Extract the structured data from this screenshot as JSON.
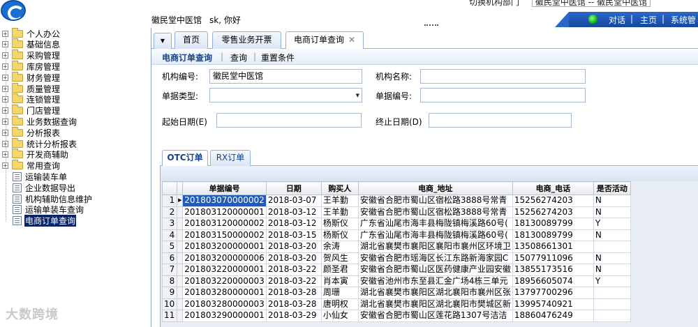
{
  "header": {
    "top_switch_label": "切换机构部门",
    "top_switch_value": "徽民堂中医馆 -- 徽民堂中医馆",
    "org_name": "徽民堂中医馆",
    "greeting": "sk, 你好",
    "nav": {
      "dialog": "对话",
      "home": "主页",
      "settings": "系统管"
    },
    "nav_sep": "|",
    "nav_color": "#1f56b3"
  },
  "tree": {
    "folders": [
      "个人办公",
      "基础信息",
      "采购管理",
      "库房管理",
      "财务管理",
      "质量管理",
      "连锁管理",
      "门店管理",
      "业务数据查询",
      "分析报表",
      "统计分析报表",
      "开发商辅助",
      "常用查询"
    ],
    "leaves": [
      "运输装车单",
      "企业数据导出",
      "机构辅助信息维护",
      "运输单装车查询",
      "电商订单查询"
    ],
    "selected": "电商订单查询",
    "expand_glyph": "+"
  },
  "watermark": "大数跨境",
  "tabs": {
    "menu_icon": "▼",
    "items": [
      "首页",
      "零售业务开票",
      "电商订单查询"
    ],
    "active": "电商订单查询",
    "close_glyph": "✕"
  },
  "toolbar": {
    "title": "电商订单查询",
    "query": "查询",
    "reset": "重置条件",
    "sep": "|"
  },
  "form": {
    "org_code_label": "机构编号:",
    "org_code_value": "徽民堂中医馆",
    "org_name_label": "机构名称:",
    "org_name_value": "",
    "doc_type_label": "单据类型:",
    "doc_type_value": "",
    "doc_no_label": "单据编号:",
    "doc_no_value": "",
    "start_label": "起始日期(E)",
    "start_value": "",
    "end_label": "终止日期(D)",
    "end_value": ""
  },
  "subtabs": {
    "items": [
      "OTC订单",
      "RX订单"
    ],
    "active": "OTC订单"
  },
  "grid": {
    "columns": [
      "单据编号",
      "日期",
      "购买人",
      "电商_地址",
      "电商_电话",
      "是否活动"
    ],
    "current_indicator": "▶",
    "rows": [
      {
        "no": "1",
        "id": "201803070000002",
        "date": "2018-03-07",
        "buyer": "王羊勤",
        "addr": "安徽省合肥市蜀山区宿松路3888号常青",
        "phone": "15256274203",
        "act": "N"
      },
      {
        "no": "2",
        "id": "201803120000001",
        "date": "2018-03-12",
        "buyer": "王羊勤",
        "addr": "安徽省合肥市蜀山区宿松路3888号常青",
        "phone": "15256274203",
        "act": "N"
      },
      {
        "no": "3",
        "id": "201803120000002",
        "date": "2018-03-12",
        "buyer": "杨斯仪",
        "addr": "广东省汕尾市海丰县梅陇镇梅溪路60号(",
        "phone": "18130089799",
        "act": "Y"
      },
      {
        "no": "4",
        "id": "201803150000002",
        "date": "2018-03-15",
        "buyer": "杨斯仪",
        "addr": "广东省汕尾市海丰县梅陇镇梅溪路60号(",
        "phone": "18130089799",
        "act": "N"
      },
      {
        "no": "5",
        "id": "201803200000001",
        "date": "2018-03-20",
        "buyer": "余涛",
        "addr": "湖北省襄樊市襄阳区襄阳市襄州区环境卫",
        "phone": "13508661301",
        "act": ""
      },
      {
        "no": "6",
        "id": "201803200000006",
        "date": "2018-03-20",
        "buyer": "贺风生",
        "addr": "安徽省合肥市瑶海区长江东路新海家园C",
        "phone": "15077911096",
        "act": "N"
      },
      {
        "no": "7",
        "id": "201803220000001",
        "date": "2018-03-22",
        "buyer": "颜圣君",
        "addr": "安徽省合肥市蜀山区医药健康产业园安徽",
        "phone": "13855173516",
        "act": "N"
      },
      {
        "no": "8",
        "id": "201803220000003",
        "date": "2018-03-22",
        "buyer": "肖本寅",
        "addr": "安徽省池州市东至县汇金广场4栋三单元",
        "phone": "18956605074",
        "act": "Y"
      },
      {
        "no": "9",
        "id": "201803280000001",
        "date": "2018-03-28",
        "buyer": "周珊",
        "addr": "湖北省襄樊市襄阳区湖北襄阳市襄州区张",
        "phone": "13797700296",
        "act": ""
      },
      {
        "no": "10",
        "id": "201803280000003",
        "date": "2018-03-28",
        "buyer": "唐明权",
        "addr": "湖北省襄樊市襄阳区湖北襄阳市樊城区新",
        "phone": "13995740921",
        "act": ""
      },
      {
        "no": "11",
        "id": "201803290000001",
        "date": "2018-03-29",
        "buyer": "小仙女",
        "addr": "安徽省合肥市蜀山区莲花路1307号洁洁",
        "phone": "18860476249",
        "act": ""
      }
    ]
  }
}
